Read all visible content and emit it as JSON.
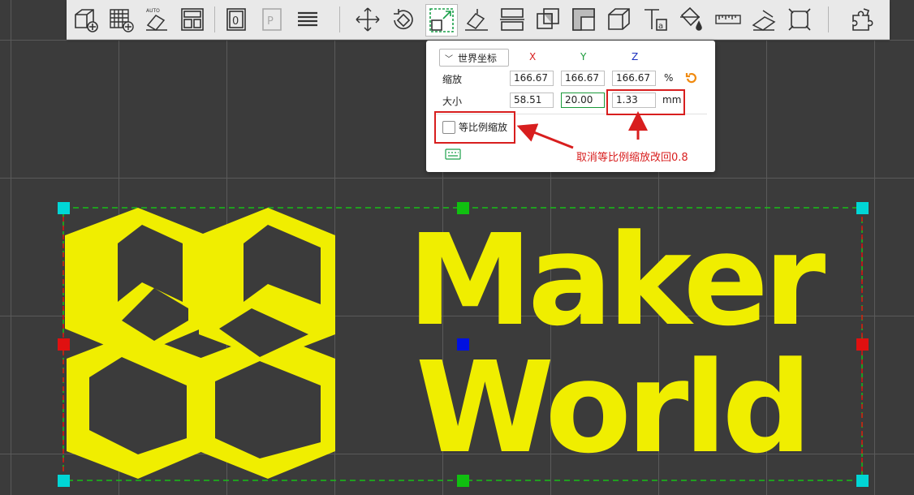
{
  "colors": {
    "accent_yellow": "#f0ee00",
    "x_axis": "#d81e1e",
    "y_axis": "#1a9a3a",
    "z_axis": "#1a2fbf",
    "annotation_red": "#d81e1e",
    "handle_cyan": "#00d6d6",
    "handle_green": "#10c010",
    "handle_red": "#e01010",
    "handle_blue": "#0010e0"
  },
  "toolbar": {
    "icons": [
      "add-cube-icon",
      "add-grid-icon",
      "auto-orient-icon",
      "arrange-icon",
      "plate-zero-icon",
      "plate-p-icon",
      "layers-icon",
      "move-icon",
      "rotate-icon",
      "scale-icon",
      "place-on-face-icon",
      "split-icon",
      "cut-icon",
      "boolean-icon",
      "support-paint-icon",
      "text-icon",
      "color-paint-icon",
      "measure-icon",
      "seam-paint-icon",
      "assembly-icon",
      "puzzle-icon"
    ]
  },
  "panel": {
    "coordinate_system": "世界坐标",
    "axes": {
      "x": "X",
      "y": "Y",
      "z": "Z"
    },
    "scale": {
      "label": "缩放",
      "x": "166.67",
      "y": "166.67",
      "z": "166.67",
      "unit": "%"
    },
    "size": {
      "label": "大小",
      "x": "58.51",
      "y": "20.00",
      "z": "1.33",
      "unit": "mm"
    },
    "uniform_scale_label": "等比例缩放",
    "uniform_scale_checked": false
  },
  "annotation": {
    "text": "取消等比例缩放改回0.8"
  },
  "model": {
    "line1": "Maker",
    "line2": "World"
  }
}
